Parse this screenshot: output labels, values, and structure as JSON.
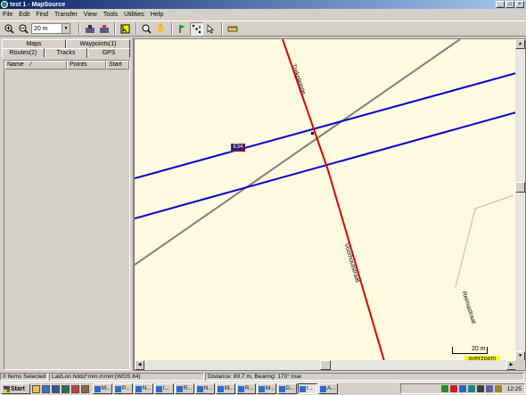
{
  "window": {
    "title": "test 1 - MapSource",
    "minimize": "_",
    "maximize": "□",
    "close": "×"
  },
  "menu": [
    "File",
    "Edit",
    "Find",
    "Transfer",
    "View",
    "Tools",
    "Utilities",
    "Help"
  ],
  "toolbar": {
    "zoom_value": "20 m",
    "icons": [
      "zoom-in-icon",
      "zoom-out-icon",
      "receive-from-device-icon",
      "send-to-device-icon",
      "select-icon",
      "zoom-tool-icon",
      "pan-icon",
      "waypoint-tool-icon",
      "route-tool-icon",
      "track-tool-icon",
      "distance-bearing-icon"
    ]
  },
  "left_panel": {
    "tabs_top": [
      "Maps",
      "Waypoints(1)"
    ],
    "tabs_bottom": [
      "Routes(2)",
      "Tracks",
      "GPS"
    ],
    "selected_tab": "Tracks",
    "columns": [
      "Name",
      "Points",
      "Start"
    ]
  },
  "map": {
    "street_labels": [
      "Trekpleintje",
      "Voorhoutstraat",
      "Reimastraat"
    ],
    "route_shield": "E34",
    "scale_label": "20 m",
    "overzoom_label": "overzoom",
    "colors": {
      "background": "#fffbe0",
      "route": "#0000cc",
      "road": "#dd0000",
      "street": "#808080",
      "minor": "#d8a8a0"
    }
  },
  "status": {
    "selected": "0 Items Selected",
    "format": "Lat/Lon hddd°mm.mmm'(WGS 84)",
    "measure": "Distance: 89.7 m, Bearing: 170° true"
  },
  "taskbar": {
    "start": "Start",
    "tasks": [
      "M...",
      "P...",
      "N...",
      "I...",
      "R...",
      "N...",
      "M...",
      "R...",
      "M...",
      "D...",
      "t...",
      "A..."
    ],
    "clock": "12:25"
  }
}
